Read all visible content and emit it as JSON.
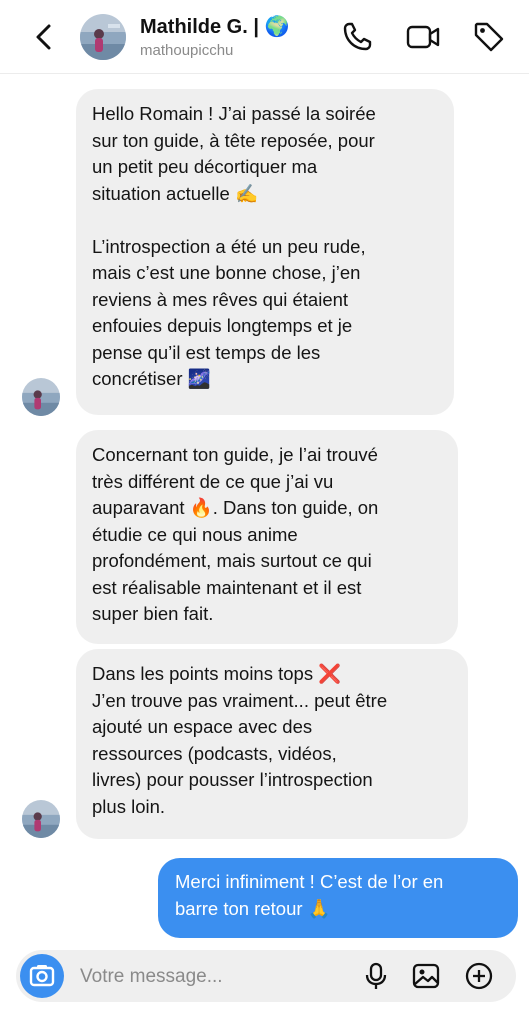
{
  "header": {
    "name": "Mathilde G. | 🌍",
    "username": "mathoupicchu",
    "icons": [
      "back-chevron-icon",
      "phone-icon",
      "video-camera-icon",
      "tag-icon"
    ]
  },
  "messages": [
    {
      "direction": "incoming",
      "text": "Hello Romain ! J’ai passé la soirée\nsur ton guide, à tête reposée, pour\nun petit peu décortiquer ma\nsituation actuelle ✍️\n\nL’introspection a été un peu rude,\nmais c’est une bonne chose, j’en\nreviens à mes rêves qui étaient\nenfouies depuis longtemps et je\npense qu’il est temps de les\nconcrétiser 🌌"
    },
    {
      "direction": "incoming",
      "text": "Concernant ton guide, je l’ai trouvé\ntrès différent de ce que j’ai vu\nauparavant 🔥. Dans ton guide, on\nétudie ce qui nous anime\nprofondément, mais surtout ce qui\nest réalisable maintenant et il est\nsuper bien fait."
    },
    {
      "direction": "incoming",
      "text": "Dans les points moins tops ❌\nJ’en trouve pas vraiment... peut être\najouté un espace avec des\nressources (podcasts, vidéos,\nlivres) pour pousser l’introspection\nplus loin."
    },
    {
      "direction": "outgoing",
      "text": "Merci infiniment ! C’est de l’or en\nbarre ton retour 🙏"
    }
  ],
  "composer": {
    "placeholder": "Votre message...",
    "icons": [
      "camera-icon",
      "microphone-icon",
      "image-icon",
      "add-icon"
    ]
  },
  "colors": {
    "incoming_bubble": "#efefef",
    "outgoing_bubble": "#3b8ff0",
    "camera_button": "#3b8ff0"
  }
}
